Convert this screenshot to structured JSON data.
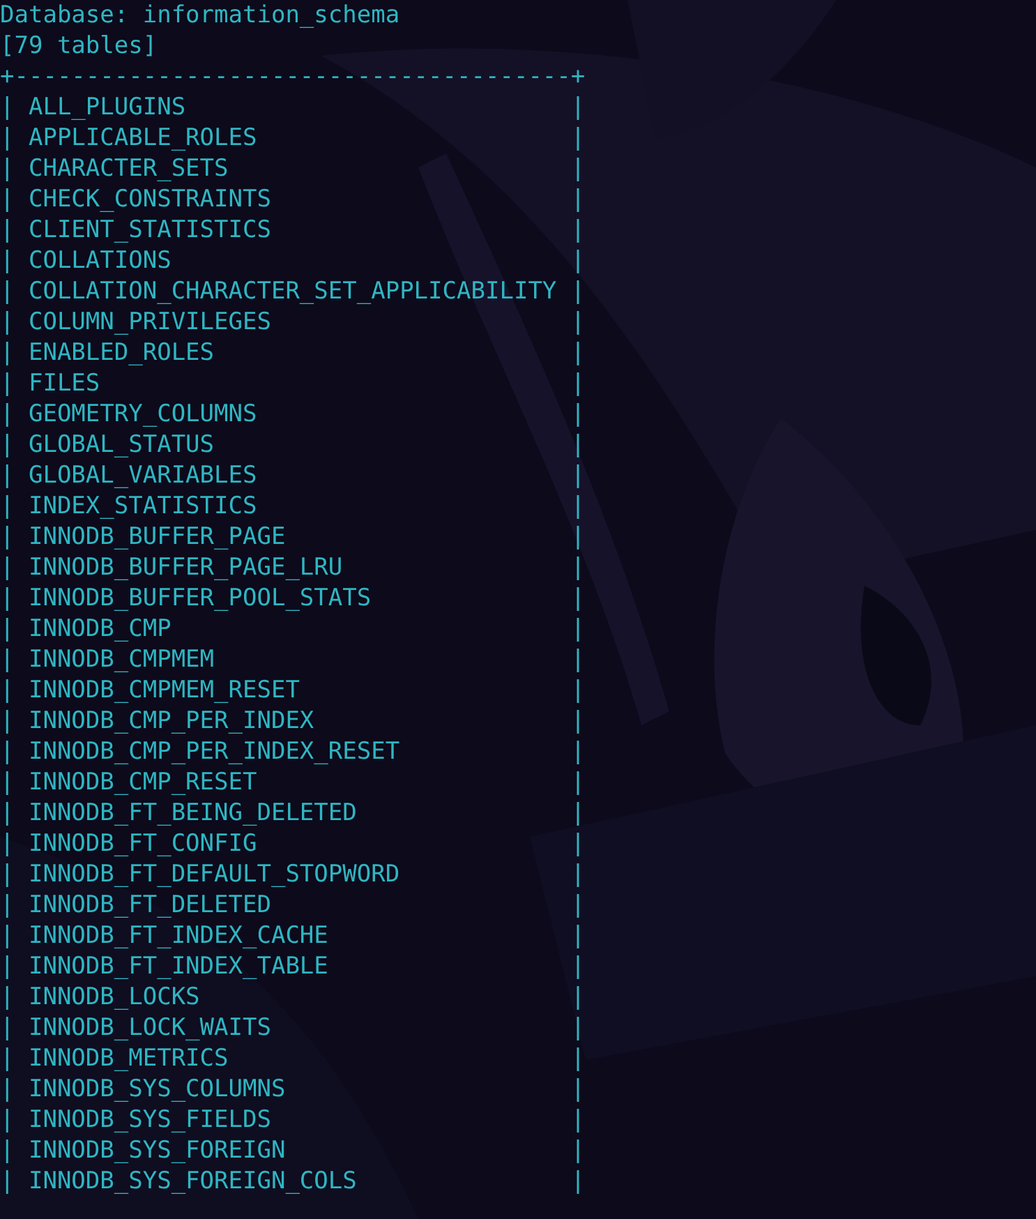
{
  "terminal": {
    "lines": [
      {
        "kind": "text",
        "text": "Database: information_schema"
      },
      {
        "kind": "text",
        "text": "[79 tables]"
      },
      {
        "kind": "rule",
        "text": "+---------------------------------------+"
      },
      {
        "kind": "row",
        "left": "|",
        "name": "ALL_PLUGINS",
        "right": "|"
      },
      {
        "kind": "row",
        "left": "|",
        "name": "APPLICABLE_ROLES",
        "right": "|"
      },
      {
        "kind": "row",
        "left": "|",
        "name": "CHARACTER_SETS",
        "right": "|"
      },
      {
        "kind": "row",
        "left": "|",
        "name": "CHECK_CONSTRAINTS",
        "right": "|"
      },
      {
        "kind": "row",
        "left": "|",
        "name": "CLIENT_STATISTICS",
        "right": "|"
      },
      {
        "kind": "row",
        "left": "|",
        "name": "COLLATIONS",
        "right": "|"
      },
      {
        "kind": "row",
        "left": "|",
        "name": "COLLATION_CHARACTER_SET_APPLICABILITY",
        "right": "|"
      },
      {
        "kind": "row",
        "left": "|",
        "name": "COLUMN_PRIVILEGES",
        "right": "|"
      },
      {
        "kind": "row",
        "left": "|",
        "name": "ENABLED_ROLES",
        "right": "|"
      },
      {
        "kind": "row",
        "left": "|",
        "name": "FILES",
        "right": "|"
      },
      {
        "kind": "row",
        "left": "|",
        "name": "GEOMETRY_COLUMNS",
        "right": "|"
      },
      {
        "kind": "row",
        "left": "|",
        "name": "GLOBAL_STATUS",
        "right": "|"
      },
      {
        "kind": "row",
        "left": "|",
        "name": "GLOBAL_VARIABLES",
        "right": "|"
      },
      {
        "kind": "row",
        "left": "|",
        "name": "INDEX_STATISTICS",
        "right": "|"
      },
      {
        "kind": "row",
        "left": "|",
        "name": "INNODB_BUFFER_PAGE",
        "right": "|"
      },
      {
        "kind": "row",
        "left": "|",
        "name": "INNODB_BUFFER_PAGE_LRU",
        "right": "|"
      },
      {
        "kind": "row",
        "left": "|",
        "name": "INNODB_BUFFER_POOL_STATS",
        "right": "|"
      },
      {
        "kind": "row",
        "left": "|",
        "name": "INNODB_CMP",
        "right": "|"
      },
      {
        "kind": "row",
        "left": "|",
        "name": "INNODB_CMPMEM",
        "right": "|"
      },
      {
        "kind": "row",
        "left": "|",
        "name": "INNODB_CMPMEM_RESET",
        "right": "|"
      },
      {
        "kind": "row",
        "left": "|",
        "name": "INNODB_CMP_PER_INDEX",
        "right": "|"
      },
      {
        "kind": "row",
        "left": "|",
        "name": "INNODB_CMP_PER_INDEX_RESET",
        "right": "|"
      },
      {
        "kind": "row",
        "left": "|",
        "name": "INNODB_CMP_RESET",
        "right": "|"
      },
      {
        "kind": "row",
        "left": "|",
        "name": "INNODB_FT_BEING_DELETED",
        "right": "|"
      },
      {
        "kind": "row",
        "left": "|",
        "name": "INNODB_FT_CONFIG",
        "right": "|"
      },
      {
        "kind": "row",
        "left": "|",
        "name": "INNODB_FT_DEFAULT_STOPWORD",
        "right": "|"
      },
      {
        "kind": "row",
        "left": "|",
        "name": "INNODB_FT_DELETED",
        "right": "|"
      },
      {
        "kind": "row",
        "left": "|",
        "name": "INNODB_FT_INDEX_CACHE",
        "right": "|"
      },
      {
        "kind": "row",
        "left": "|",
        "name": "INNODB_FT_INDEX_TABLE",
        "right": "|"
      },
      {
        "kind": "row",
        "left": "|",
        "name": "INNODB_LOCKS",
        "right": "|"
      },
      {
        "kind": "row",
        "left": "|",
        "name": "INNODB_LOCK_WAITS",
        "right": "|"
      },
      {
        "kind": "row",
        "left": "|",
        "name": "INNODB_METRICS",
        "right": "|"
      },
      {
        "kind": "row",
        "left": "|",
        "name": "INNODB_SYS_COLUMNS",
        "right": "|"
      },
      {
        "kind": "row",
        "left": "|",
        "name": "INNODB_SYS_FIELDS",
        "right": "|"
      },
      {
        "kind": "row",
        "left": "|",
        "name": "INNODB_SYS_FOREIGN",
        "right": "|"
      },
      {
        "kind": "row",
        "left": "|",
        "name": "INNODB_SYS_FOREIGN_COLS",
        "right": "|"
      }
    ]
  }
}
